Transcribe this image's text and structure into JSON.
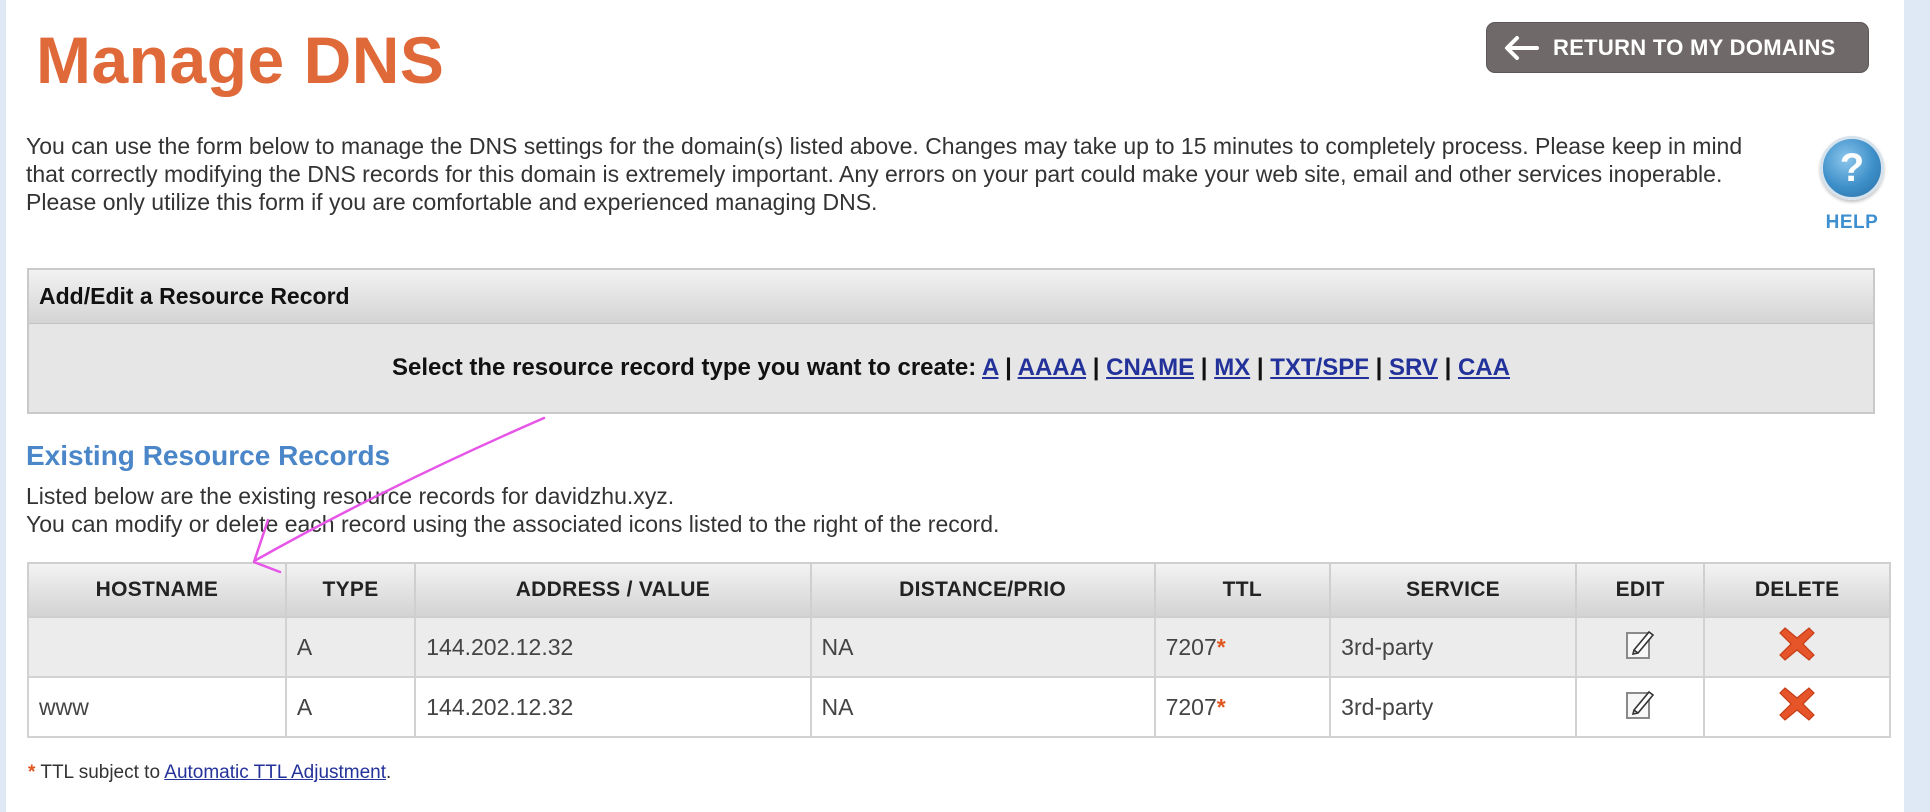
{
  "page": {
    "title": "Manage DNS",
    "return_button": "RETURN TO MY DOMAINS",
    "intro_text": "You can use the form below to manage the DNS settings for the domain(s) listed above. Changes may take up to 15 minutes to completely process. Please keep in mind that correctly modifying the DNS records for this domain is extremely important. Any errors on your part could make your web site, email and other services inoperable. Please only utilize this form if you are comfortable and experienced managing DNS.",
    "help_label": "HELP",
    "help_icon": "question-mark-icon"
  },
  "add_edit": {
    "header": "Add/Edit a Resource Record",
    "prompt": "Select the resource record type you want to create:",
    "types": [
      "A",
      "AAAA",
      "CNAME",
      "MX",
      "TXT/SPF",
      "SRV",
      "CAA"
    ],
    "separator": "|"
  },
  "existing": {
    "title": "Existing Resource Records",
    "desc_line1": "Listed below are the existing resource records for davidzhu.xyz.",
    "desc_line2": "You can modify or delete each record using the associated icons listed to the right of the record."
  },
  "table": {
    "columns": [
      "HOSTNAME",
      "TYPE",
      "ADDRESS / VALUE",
      "DISTANCE/PRIO",
      "TTL",
      "SERVICE",
      "EDIT",
      "DELETE"
    ],
    "rows": [
      {
        "hostname": "",
        "type": "A",
        "address": "144.202.12.32",
        "distance": "NA",
        "ttl": "7207",
        "ttl_mark": "*",
        "service": "3rd-party",
        "edit_icon": "edit-icon",
        "delete_icon": "delete-x-icon"
      },
      {
        "hostname": "www",
        "type": "A",
        "address": "144.202.12.32",
        "distance": "NA",
        "ttl": "7207",
        "ttl_mark": "*",
        "service": "3rd-party",
        "edit_icon": "edit-icon",
        "delete_icon": "delete-x-icon"
      }
    ]
  },
  "footnote": {
    "star": "*",
    "text": "TTL subject to",
    "link": "Automatic TTL Adjustment",
    "end": "."
  },
  "colors": {
    "title_orange": "#e0693a",
    "section_blue": "#4a86c8",
    "link_blue": "#23329a",
    "button_gray": "#6f6a69",
    "annotation_magenta": "#e655e8"
  }
}
